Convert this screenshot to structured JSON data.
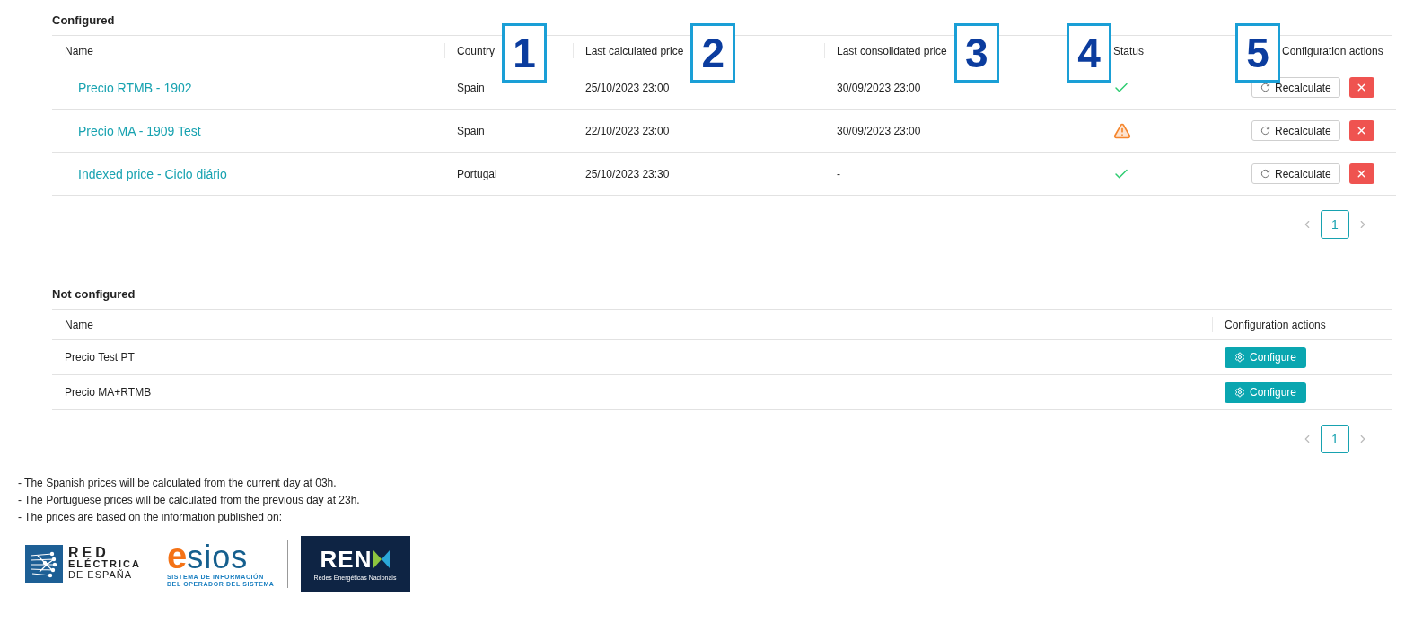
{
  "configured": {
    "title": "Configured",
    "columns": [
      {
        "label": "Name"
      },
      {
        "label": "Country",
        "callout": {
          "label": "1",
          "kind": "after"
        }
      },
      {
        "label": "Last calculated price",
        "callout": {
          "label": "2",
          "kind": "after"
        }
      },
      {
        "label": "Last consolidated price",
        "callout": {
          "label": "3",
          "kind": "after"
        }
      },
      {
        "label": "Status",
        "callout": {
          "label": "4",
          "kind": "before"
        }
      },
      {
        "label": "Configuration actions",
        "callout": {
          "label": "5",
          "kind": "before"
        }
      }
    ],
    "rows": [
      {
        "name": "Precio RTMB - 1902",
        "country": "Spain",
        "last_calculated": "25/10/2023 23:00",
        "last_consolidated": "30/09/2023 23:00",
        "kind": "ok",
        "action": "Recalculate"
      },
      {
        "name": "Precio MA - 1909 Test",
        "country": "Spain",
        "last_calculated": "22/10/2023 23:00",
        "last_consolidated": "30/09/2023 23:00",
        "kind": "warning",
        "action": "Recalculate"
      },
      {
        "name": "Indexed price - Ciclo diário",
        "country": "Portugal",
        "last_calculated": "25/10/2023 23:30",
        "last_consolidated": "-",
        "kind": "ok",
        "action": "Recalculate"
      }
    ],
    "pagination": {
      "pages": [
        {
          "label": "1",
          "selected": true
        }
      ]
    }
  },
  "not_configured": {
    "title": "Not configured",
    "columns": [
      {
        "label": "Name"
      },
      {
        "label": "Configuration actions"
      }
    ],
    "rows": [
      {
        "name": "Precio Test PT",
        "action": "Configure"
      },
      {
        "name": "Precio MA+RTMB",
        "action": "Configure"
      }
    ],
    "pagination": {
      "pages": [
        {
          "label": "1",
          "selected": true
        }
      ]
    }
  },
  "notes": [
    "- The Spanish prices will be calculated from the current day at 03h.",
    "- The Portuguese prices will be calculated from the previous day at 23h.",
    "- The prices are based on the information published on:"
  ],
  "logos": {
    "ree": [
      "RED",
      "ELÉCTRICA",
      "DE ESPAÑA"
    ],
    "esios": {
      "mark": "e",
      "name": "sios",
      "subtitle": [
        "SISTEMA DE INFORMACIÓN",
        "DEL OPERADOR DEL SISTEMA"
      ]
    },
    "ren": {
      "name": "REN",
      "subtitle": "Redes Energéticas Nacionais"
    }
  }
}
